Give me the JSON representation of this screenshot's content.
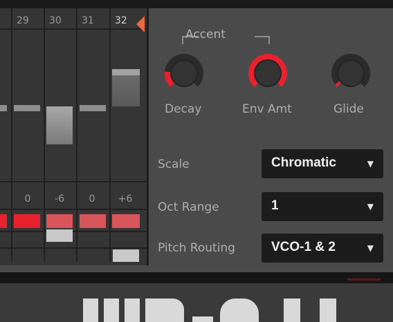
{
  "sequencer": {
    "step_numbers": [
      "29",
      "30",
      "31",
      "32"
    ],
    "transpose_values": [
      "0",
      "-6",
      "0",
      "+6"
    ]
  },
  "accent": {
    "title": "Accent",
    "knobs": [
      {
        "label": "Decay",
        "color": "#e8212f"
      },
      {
        "label": "Env Amt",
        "color": "#e8212f"
      },
      {
        "label": "Glide",
        "color": "#e8212f"
      }
    ]
  },
  "settings": {
    "scale": {
      "label": "Scale",
      "value": "Chromatic"
    },
    "oct_range": {
      "label": "Oct Range",
      "value": "1"
    },
    "pitch_routing": {
      "label": "Pitch Routing",
      "value": "VCO-1 & 2"
    }
  },
  "colors": {
    "accent_red": "#e8212f",
    "accent_dim": "#d9555c",
    "playhead": "#e86a3e"
  },
  "icons": {
    "dropdown": "triangle-down"
  }
}
